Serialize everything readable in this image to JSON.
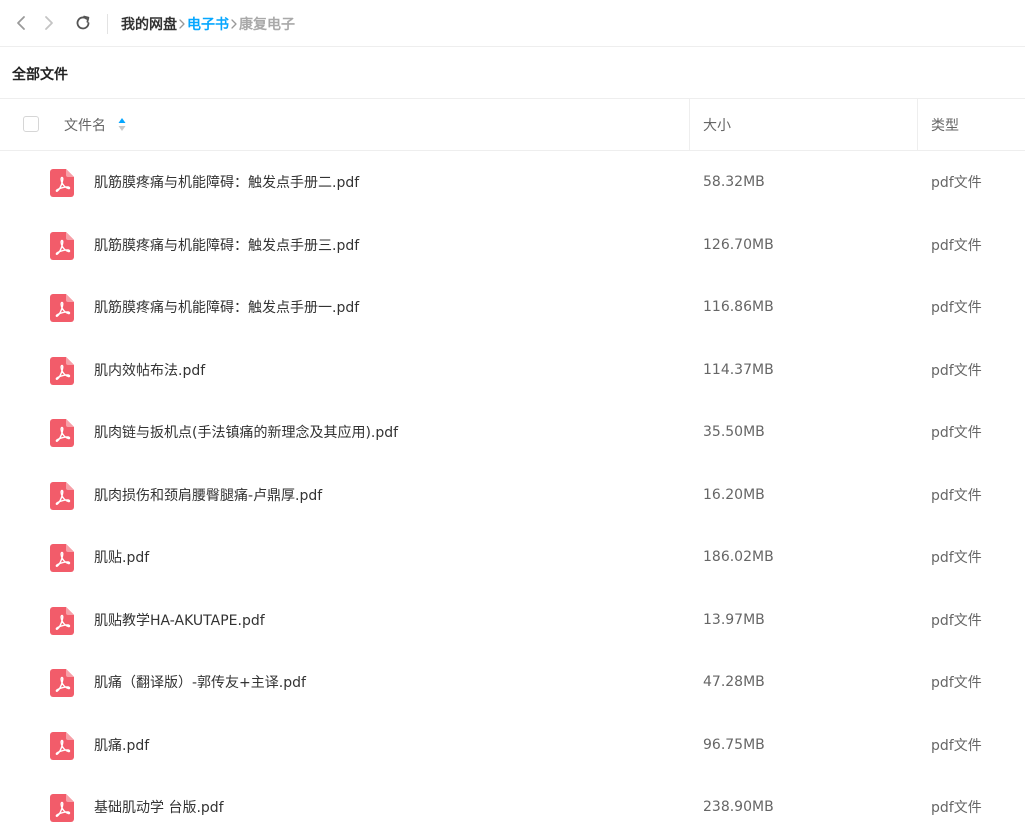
{
  "nav": {
    "back_icon": "chevron-left-icon",
    "forward_icon": "chevron-right-icon",
    "refresh_icon": "refresh-icon"
  },
  "breadcrumb": {
    "items": [
      "我的网盘",
      "电子书",
      "康复电子"
    ],
    "active_color": "#06a7ff"
  },
  "section": {
    "title": "全部文件"
  },
  "table": {
    "columns": {
      "name": "文件名",
      "size": "大小",
      "type": "类型"
    },
    "sort_color": "#06a7ff",
    "rows": [
      {
        "name": "肌筋膜疼痛与机能障碍：触发点手册二.pdf",
        "size": "58.32MB",
        "type": "pdf文件",
        "icon": "pdf-file-icon"
      },
      {
        "name": "肌筋膜疼痛与机能障碍：触发点手册三.pdf",
        "size": "126.70MB",
        "type": "pdf文件",
        "icon": "pdf-file-icon"
      },
      {
        "name": "肌筋膜疼痛与机能障碍：触发点手册一.pdf",
        "size": "116.86MB",
        "type": "pdf文件",
        "icon": "pdf-file-icon"
      },
      {
        "name": "肌内效帖布法.pdf",
        "size": "114.37MB",
        "type": "pdf文件",
        "icon": "pdf-file-icon"
      },
      {
        "name": "肌肉链与扳机点(手法镇痛的新理念及其应用).pdf",
        "size": "35.50MB",
        "type": "pdf文件",
        "icon": "pdf-file-icon"
      },
      {
        "name": "肌肉损伤和颈肩腰臀腿痛-卢鼎厚.pdf",
        "size": "16.20MB",
        "type": "pdf文件",
        "icon": "pdf-file-icon"
      },
      {
        "name": "肌贴.pdf",
        "size": "186.02MB",
        "type": "pdf文件",
        "icon": "pdf-file-icon"
      },
      {
        "name": "肌贴教学HA-AKUTAPE.pdf",
        "size": "13.97MB",
        "type": "pdf文件",
        "icon": "pdf-file-icon"
      },
      {
        "name": "肌痛（翻译版）-郭传友+主译.pdf",
        "size": "47.28MB",
        "type": "pdf文件",
        "icon": "pdf-file-icon"
      },
      {
        "name": "肌痛.pdf",
        "size": "96.75MB",
        "type": "pdf文件",
        "icon": "pdf-file-icon"
      },
      {
        "name": "基础肌动学 台版.pdf",
        "size": "238.90MB",
        "type": "pdf文件",
        "icon": "pdf-file-icon"
      }
    ]
  },
  "colors": {
    "pdf_icon": "#f25c6a",
    "divider": "#eeeeee"
  }
}
